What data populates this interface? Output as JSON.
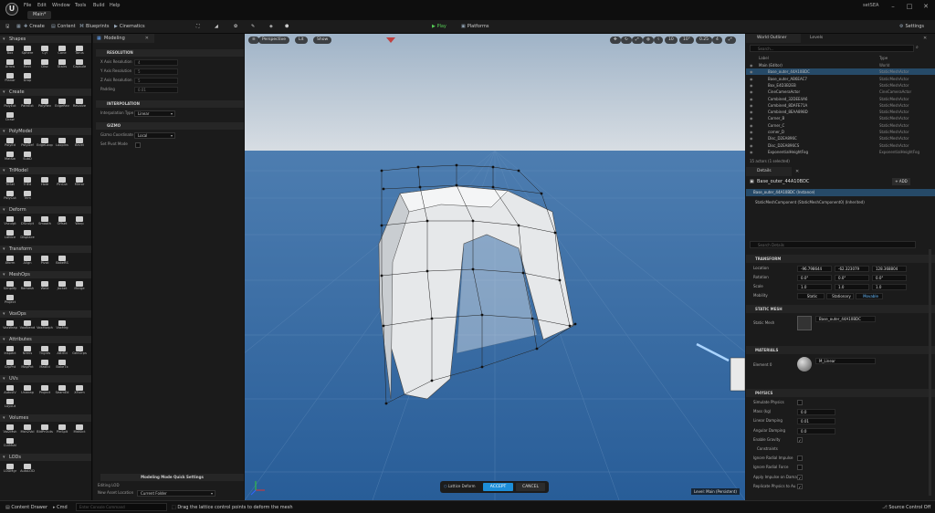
{
  "menu": [
    "File",
    "Edit",
    "Window",
    "Tools",
    "Build",
    "Help"
  ],
  "map_tab": "Main*",
  "project_name": "setSEA",
  "toolbar": {
    "save_icon": "save-icon",
    "mode": "Modeling",
    "create": "Create",
    "content": "Content",
    "blueprints": "Blueprints",
    "cinematics": "Cinematics",
    "play": "Play",
    "platforms": "Platforms",
    "settings": "Settings"
  },
  "left_panel": {
    "sections": [
      {
        "title": "Shapes",
        "tools": [
          "Box",
          "Sphere",
          "Cyl",
          "Cone",
          "Torus",
          "Arrow",
          "Rect",
          "Disc",
          "Stairs",
          "Capsule",
          "Planar",
          "Drop"
        ]
      },
      {
        "title": "Create",
        "tools": [
          "PolyExt",
          "PathExt",
          "PolyRev",
          "EdgeRev",
          "Revolve",
          "Draw"
        ]
      },
      {
        "title": "PolyModel",
        "tools": [
          "PolyEd",
          "PolyDef",
          "EdgeLoop",
          "Loopins",
          "Bevel",
          "MatSw",
          "SubD"
        ]
      },
      {
        "title": "TriModel",
        "tools": [
          "TriSel",
          "TriEd",
          "Hole",
          "PlnCut",
          "Mirror",
          "PolyCut",
          "Trim"
        ]
      },
      {
        "title": "Deform",
        "tools": [
          "Vsculpt",
          "DSculpt",
          "Smooth",
          "Offset",
          "Warp",
          "Lattice",
          "Displace"
        ]
      },
      {
        "title": "Transform",
        "tools": [
          "Xform",
          "Align",
          "Pivot",
          "BakeRS"
        ]
      },
      {
        "title": "MeshOps",
        "tools": [
          "Simplify",
          "Remesh",
          "Weld",
          "Jacket",
          "Merge",
          "Project"
        ]
      },
      {
        "title": "VoxOps",
        "tools": [
          "VoxWrap",
          "VoxBlend",
          "VoxMorph",
          "VoxMrg"
        ]
      },
      {
        "title": "Attributes",
        "tools": [
          "Inspect",
          "Nrmls",
          "Tngnts",
          "AttrEd",
          "GenGrps",
          "GrpPnt",
          "MapPnt",
          "MatEd",
          "BakeTx"
        ]
      },
      {
        "title": "UVs",
        "tools": [
          "AutoUV",
          "Unwrap",
          "Project",
          "SeamEd",
          "XForm",
          "Layout"
        ]
      },
      {
        "title": "Volumes",
        "tools": [
          "Vol2Msh",
          "Msh2Vol",
          "BldPrOuts",
          "PlnSplt",
          "MdlSlct",
          "CutMshl"
        ]
      },
      {
        "title": "LODs",
        "tools": [
          "LODMgr",
          "AutoLOD"
        ]
      }
    ]
  },
  "modeling_panel": {
    "tab": "Modeling",
    "resolution_section": "RESOLUTION",
    "x_resolution": {
      "label": "X Axis Resolution",
      "value": "4"
    },
    "y_resolution": {
      "label": "Y Axis Resolution",
      "value": "5"
    },
    "z_resolution": {
      "label": "Z Axis Resolution",
      "value": "5"
    },
    "padding": {
      "label": "Padding",
      "value": "0.01"
    },
    "interpolation_section": "INTERPOLATION",
    "interpolation_type": {
      "label": "Interpolation Type",
      "value": "Linear"
    },
    "gizmo_section": "GIZMO",
    "gizmo_coords": {
      "label": "Gizmo Coordinate",
      "value": "Local"
    },
    "set_pivot_mode": {
      "label": "Set Pivot Mode"
    },
    "quick_settings": "Modeling Mode Quick Settings",
    "editing_lod": {
      "label": "Editing LOD",
      "value": ""
    },
    "new_asset_location": {
      "label": "New Asset Location",
      "value": "Current Folder"
    }
  },
  "viewport": {
    "perspective": "Perspective",
    "lit": "Lit",
    "show": "Show",
    "right_controls": [
      "10",
      "10°",
      "0.25",
      "4"
    ],
    "level_label": "Level: Main (Persistent)",
    "lattice_label": "Lattice Deform",
    "accept": "ACCEPT",
    "cancel": "CANCEL"
  },
  "outliner": {
    "tab1": "World Outliner",
    "tab2": "Levels",
    "search_placeholder": "Search...",
    "col_label": "Label",
    "col_type": "Type",
    "rows": [
      {
        "label": "Main (Editor)",
        "type": "World"
      },
      {
        "label": "Base_outer_44A10BDC",
        "type": "StaticMeshActor"
      },
      {
        "label": "Base_outer_AB6EAC7",
        "type": "StaticMeshActor"
      },
      {
        "label": "Box_E4D3B2EB",
        "type": "StaticMeshActor"
      },
      {
        "label": "CineCameraActor",
        "type": "CineCameraActor"
      },
      {
        "label": "Combined_32DEE4A6",
        "type": "StaticMeshActor"
      },
      {
        "label": "Combined_8DAFE71A",
        "type": "StaticMeshActor"
      },
      {
        "label": "Combined_8EAA898D",
        "type": "StaticMeshActor"
      },
      {
        "label": "Corner_B",
        "type": "StaticMeshActor"
      },
      {
        "label": "Corner_C",
        "type": "StaticMeshActor"
      },
      {
        "label": "corner_D",
        "type": "StaticMeshActor"
      },
      {
        "label": "Disc_D2EA896C",
        "type": "StaticMeshActor"
      },
      {
        "label": "Disc_D2EA896CS",
        "type": "StaticMeshActor"
      },
      {
        "label": "ExponentialHeightFog",
        "type": "ExponentialHeightFog"
      }
    ],
    "footer": "15 actors (1 selected)"
  },
  "details": {
    "tab": "Details",
    "actor_name": "Base_outer_44A10BDC",
    "add_button": "+ ADD",
    "instance": "Base_outer_44A10BDC (Instance)",
    "component": "StaticMeshComponent (StaticMeshComponent0) (Inherited)",
    "search_placeholder": "Search Details",
    "transform_section": "TRANSFORM",
    "location": {
      "label": "Location",
      "x": "-96.798644",
      "y": "-62.323079",
      "z": "128.368804"
    },
    "rotation": {
      "label": "Rotation",
      "x": "0.0°",
      "y": "0.0°",
      "z": "0.0°"
    },
    "scale": {
      "label": "Scale",
      "x": "1.0",
      "y": "1.0",
      "z": "1.0"
    },
    "mobility": {
      "label": "Mobility",
      "options": [
        "Static",
        "Stationary",
        "Movable"
      ]
    },
    "static_mesh_section": "STATIC MESH",
    "static_mesh": {
      "label": "Static Mesh",
      "value": "Base_outer_44A10BDC"
    },
    "materials_section": "MATERIALS",
    "element0": {
      "label": "Element 0",
      "value": "M_Linear"
    },
    "physics_section": "PHYSICS",
    "physics_rows": [
      {
        "label": "Simulate Physics",
        "kind": "check",
        "value": ""
      },
      {
        "label": "Mass (kg)",
        "kind": "value",
        "value": "0.0"
      },
      {
        "label": "Linear Damping",
        "kind": "value",
        "value": "0.01"
      },
      {
        "label": "Angular Damping",
        "kind": "value",
        "value": "0.0"
      },
      {
        "label": "Enable Gravity",
        "kind": "check",
        "value": "✓"
      },
      {
        "label": "Constraints",
        "kind": "group",
        "value": ""
      },
      {
        "label": "Ignore Radial Impulse",
        "kind": "check",
        "value": ""
      },
      {
        "label": "Ignore Radial Force",
        "kind": "check",
        "value": ""
      },
      {
        "label": "Apply Impulse on Damage",
        "kind": "check",
        "value": "✓"
      },
      {
        "label": "Replicate Physics to Au",
        "kind": "check",
        "value": "✓"
      }
    ]
  },
  "statusbar": {
    "content_drawer": "Content Drawer",
    "cmd": "Cmd",
    "console_placeholder": "Enter Console Command",
    "hint": "Drag the lattice control points to deform the mesh",
    "source_control": "Source Control Off"
  },
  "colors": {
    "accent": "#1d8ed8",
    "sky_top": "#bcc8d4",
    "ground": "#2e66a3",
    "play": "#55cc55"
  }
}
